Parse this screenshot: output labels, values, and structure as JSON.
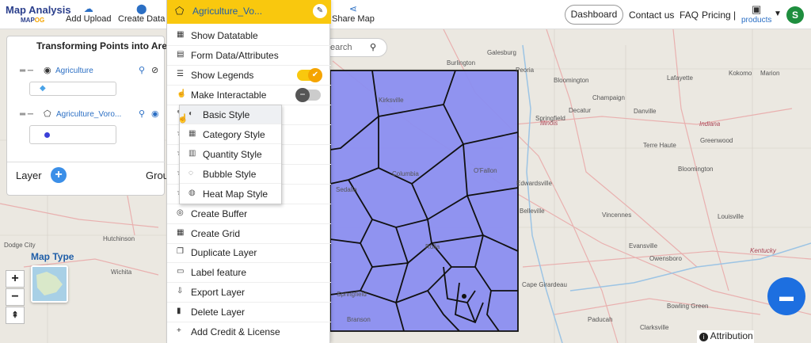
{
  "app": {
    "logo_title": "Map Analysis",
    "logo_sub_a": "MAP",
    "logo_sub_b": "OG"
  },
  "toolbar": {
    "add_upload": "Add Upload",
    "create_data": "Create Data",
    "share_map": "Share Map"
  },
  "nav": {
    "dashboard": "Dashboard",
    "contact": "Contact us",
    "faq": "FAQ",
    "pricing": "Pricing |",
    "products": "products",
    "avatar_initial": "S"
  },
  "layer_panel": {
    "title": "Transforming Points into Areas",
    "layers": [
      {
        "name": "Agriculture",
        "icon": "pin-icon"
      },
      {
        "name": "Agriculture_Voro...",
        "icon": "polygon-icon"
      }
    ],
    "layer_label": "Layer",
    "group_label": "Grou"
  },
  "menu": {
    "header_title": "Agriculture_Vo...",
    "items": [
      {
        "label": "Show Datatable",
        "icon": "table-icon"
      },
      {
        "label": "Form Data/Attributes",
        "icon": "form-icon"
      },
      {
        "label": "Show Legends",
        "icon": "list-icon"
      },
      {
        "label": "Make Interactable",
        "icon": "hand-icon"
      },
      {
        "label": "Create Buffer",
        "icon": "buffer-icon"
      },
      {
        "label": "Create Grid",
        "icon": "grid-icon"
      },
      {
        "label": "Duplicate Layer",
        "icon": "duplicate-icon"
      },
      {
        "label": "Label feature",
        "icon": "label-icon"
      },
      {
        "label": "Export Layer",
        "icon": "export-icon"
      },
      {
        "label": "Delete Layer",
        "icon": "trash-icon"
      },
      {
        "label": "Add Credit & License",
        "icon": "plus-icon"
      }
    ],
    "show_legends_on": true,
    "interactable_on": false
  },
  "style_submenu": {
    "items": [
      {
        "label": "Basic Style",
        "icon": "palette-icon"
      },
      {
        "label": "Category Style",
        "icon": "category-icon"
      },
      {
        "label": "Quantity Style",
        "icon": "quantity-icon"
      },
      {
        "label": "Bubble Style",
        "icon": "bubble-icon"
      },
      {
        "label": "Heat Map Style",
        "icon": "heatmap-icon"
      }
    ],
    "active_index": 0
  },
  "search": {
    "placeholder": "earch"
  },
  "map": {
    "map_type_label": "Map Type",
    "attribution": "Attribution",
    "polygon_fill": "#8b8ef0",
    "cities": [
      {
        "name": "Burlington"
      },
      {
        "name": "Galesburg"
      },
      {
        "name": "Peoria"
      },
      {
        "name": "Bloomington"
      },
      {
        "name": "Lafayette"
      },
      {
        "name": "Kokomo"
      },
      {
        "name": "Marion"
      },
      {
        "name": "Champaign"
      },
      {
        "name": "Danville"
      },
      {
        "name": "Springfield"
      },
      {
        "name": "Decatur"
      },
      {
        "name": "Illinois"
      },
      {
        "name": "Indiana"
      },
      {
        "name": "Terre Haute"
      },
      {
        "name": "Greenwood"
      },
      {
        "name": "Edwardsville"
      },
      {
        "name": "Bloomington"
      },
      {
        "name": "Louisville"
      },
      {
        "name": "Evansville"
      },
      {
        "name": "Owensboro"
      },
      {
        "name": "Kentucky"
      },
      {
        "name": "Bowling Green"
      },
      {
        "name": "Clarksville"
      },
      {
        "name": "Hutchinson"
      },
      {
        "name": "Dodge City"
      },
      {
        "name": "Wichita"
      },
      {
        "name": "Kirksville"
      },
      {
        "name": "Sedalia"
      },
      {
        "name": "Columbia"
      },
      {
        "name": "O'Fallon"
      },
      {
        "name": "Rolla"
      },
      {
        "name": "Springfield"
      },
      {
        "name": "Branson"
      },
      {
        "name": "Belleville"
      },
      {
        "name": "Paducah"
      },
      {
        "name": "Vincennes"
      },
      {
        "name": "Cape Girardeau"
      }
    ]
  }
}
